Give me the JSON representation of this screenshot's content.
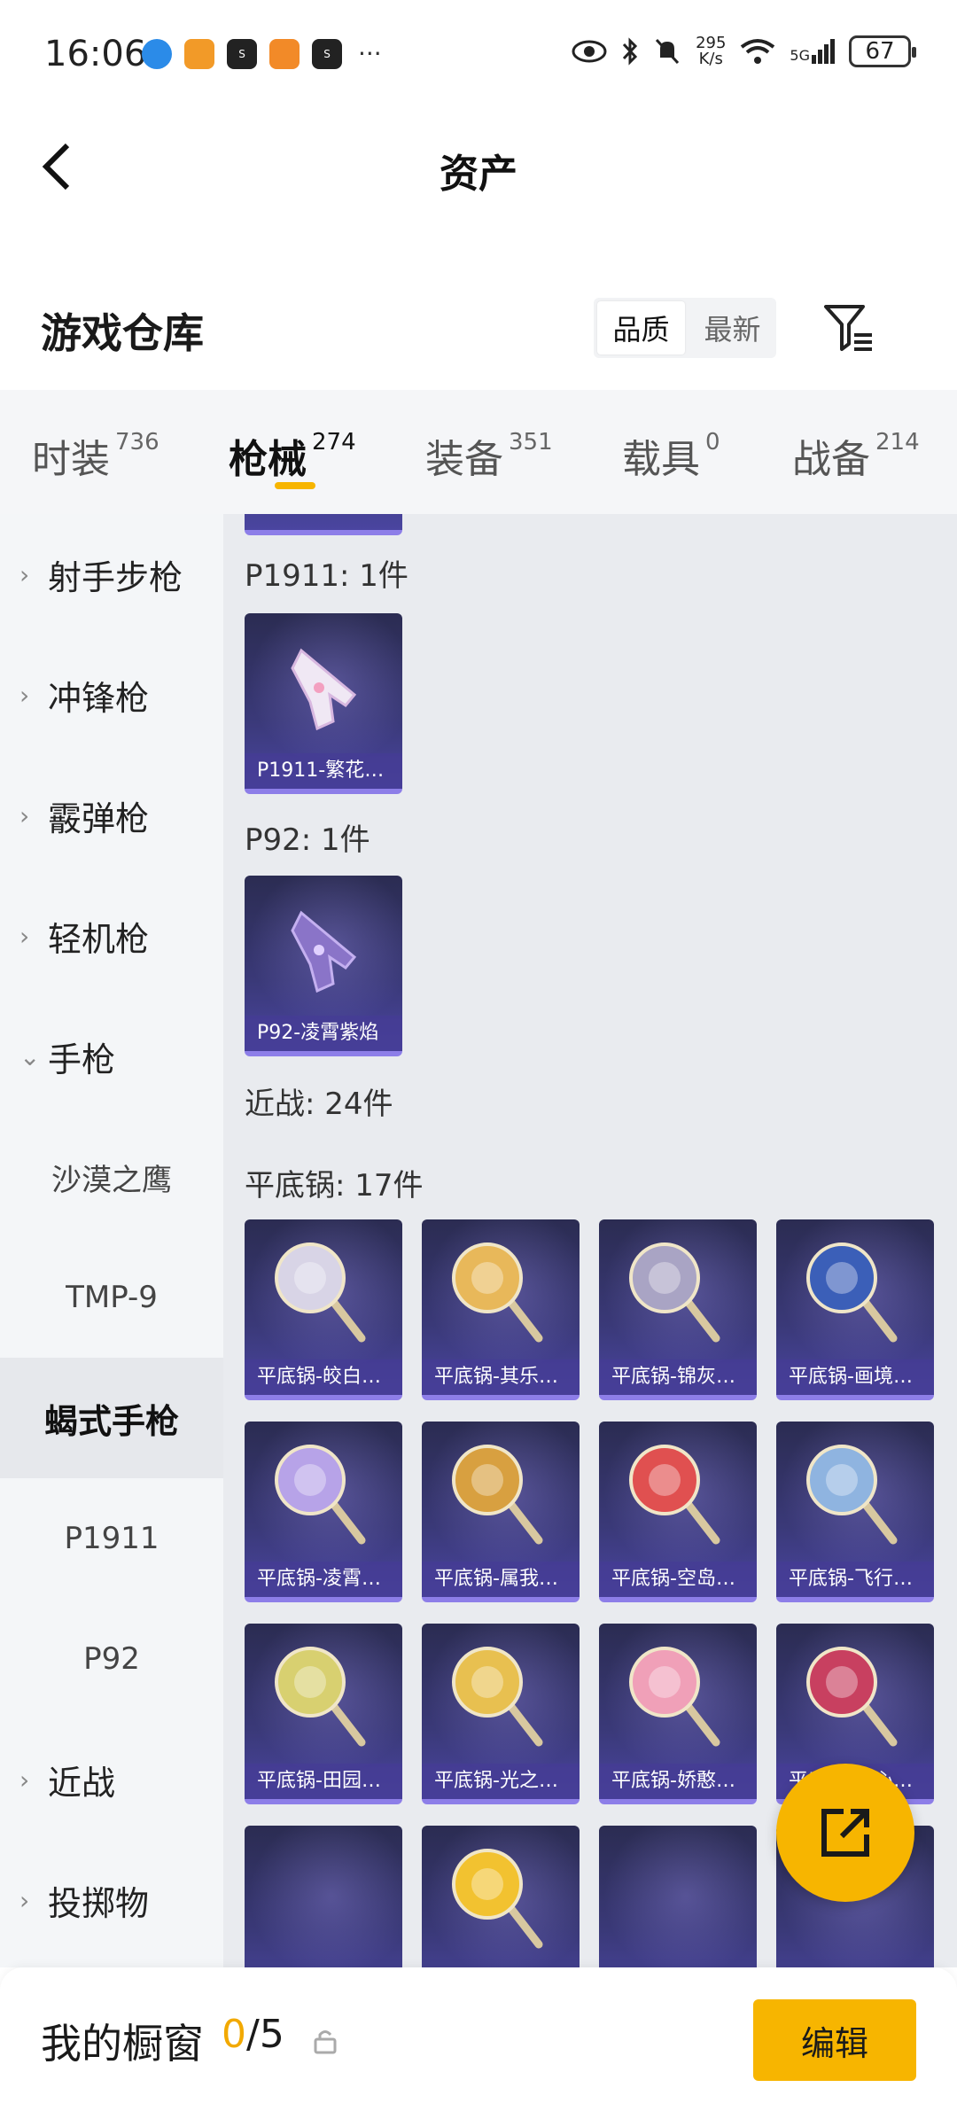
{
  "status_bar": {
    "time": "16:06",
    "net_speed_value": "295",
    "net_speed_unit": "K/s",
    "network": "5G",
    "battery": "67",
    "more": "···",
    "app_icons": [
      "browser-icon",
      "app-icon",
      "soul-icon",
      "game-icon",
      "soul-icon"
    ]
  },
  "nav": {
    "title": "资产"
  },
  "header": {
    "title": "游戏仓库",
    "sort_options": [
      "品质",
      "最新"
    ]
  },
  "tabs": [
    {
      "label": "时装",
      "count": "736"
    },
    {
      "label": "枪械",
      "count": "274"
    },
    {
      "label": "装备",
      "count": "351"
    },
    {
      "label": "载具",
      "count": "0"
    },
    {
      "label": "战备",
      "count": "214"
    }
  ],
  "sidebar": {
    "items": [
      {
        "label": "射手步枪",
        "chevron": "›"
      },
      {
        "label": "冲锋枪",
        "chevron": "›"
      },
      {
        "label": "霰弹枪",
        "chevron": "›"
      },
      {
        "label": "轻机枪",
        "chevron": "›"
      },
      {
        "label": "手枪",
        "chevron": "⌄"
      },
      {
        "label": "沙漠之鹰"
      },
      {
        "label": "TMP-9"
      },
      {
        "label": "蝎式手枪"
      },
      {
        "label": "P1911"
      },
      {
        "label": "P92"
      },
      {
        "label": "近战",
        "chevron": "›"
      },
      {
        "label": "投掷物",
        "chevron": "›"
      }
    ]
  },
  "content": {
    "sections": [
      {
        "title": "P1911: 1件"
      },
      {
        "title": "P92: 1件"
      },
      {
        "title": "近战: 24件"
      },
      {
        "title": "平底锅: 17件"
      }
    ],
    "pistol_cards": [
      {
        "label": "P1911-繁花…"
      },
      {
        "label": "P92-凌霄紫焰"
      }
    ],
    "pan_cards": [
      {
        "label": "平底锅-皎白…",
        "color": "#d8d4e6"
      },
      {
        "label": "平底锅-其乐…",
        "color": "#e8b85a"
      },
      {
        "label": "平底锅-锦灰…",
        "color": "#a9a4c4"
      },
      {
        "label": "平底锅-画境…",
        "color": "#3b5fb8"
      },
      {
        "label": "平底锅-凌霄…",
        "color": "#b7a3e8"
      },
      {
        "label": "平底锅-属我…",
        "color": "#d8a040"
      },
      {
        "label": "平底锅-空岛…",
        "color": "#e05050"
      },
      {
        "label": "平底锅-飞行…",
        "color": "#8fb4e0"
      },
      {
        "label": "平底锅-田园…",
        "color": "#d8d070"
      },
      {
        "label": "平底锅-光之…",
        "color": "#e8c050"
      },
      {
        "label": "平底锅-娇憨…",
        "color": "#f0a0b8"
      },
      {
        "label": "平底锅-…心…",
        "color": "#c84060"
      },
      {
        "label": "",
        "color": ""
      },
      {
        "label": "",
        "color": "#f2c230"
      },
      {
        "label": "",
        "color": ""
      },
      {
        "label": "",
        "color": ""
      }
    ]
  },
  "bottom_bar": {
    "title": "我的橱窗",
    "count_current": "0",
    "count_total": "/5",
    "edit_label": "编辑"
  }
}
